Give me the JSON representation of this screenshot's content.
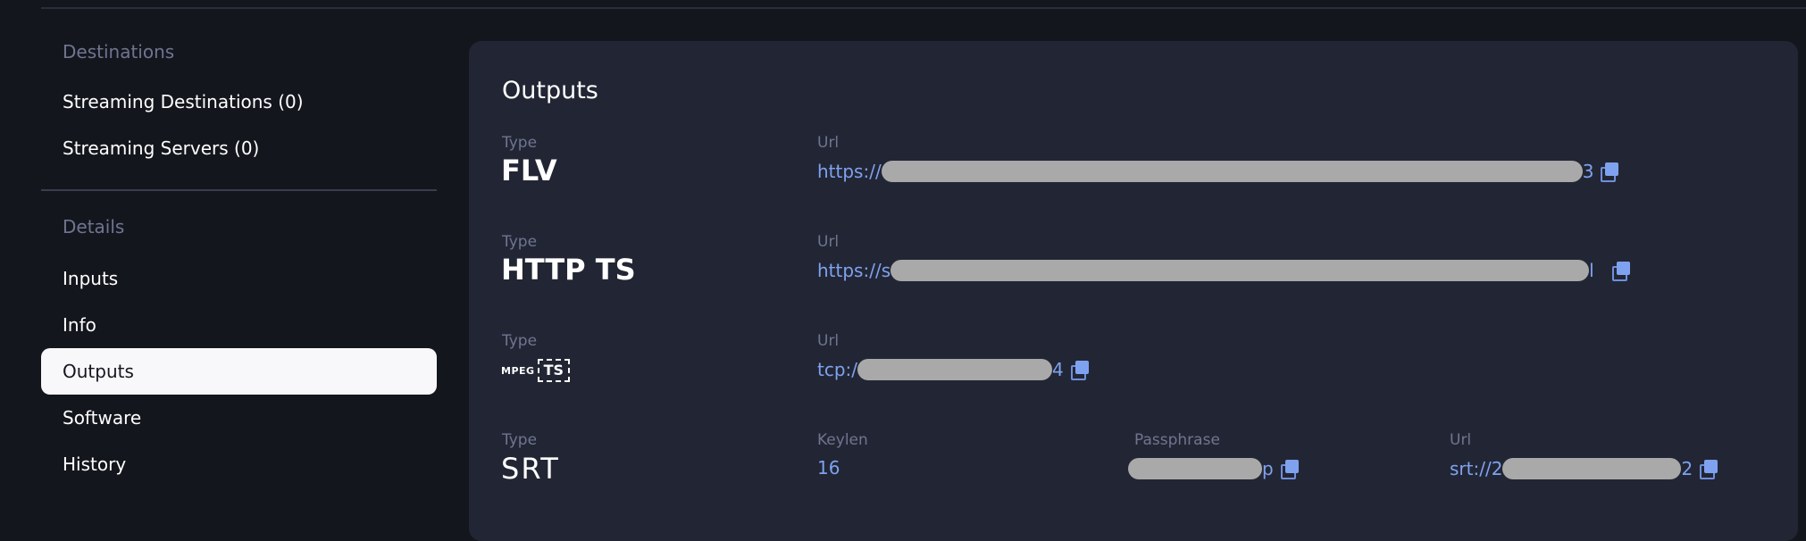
{
  "sidebar": {
    "destinations_title": "Destinations",
    "destinations": [
      {
        "label": "Streaming Destinations (0)"
      },
      {
        "label": "Streaming Servers (0)"
      }
    ],
    "details_title": "Details",
    "details": [
      {
        "label": "Inputs"
      },
      {
        "label": "Info"
      },
      {
        "label": "Outputs",
        "active": true
      },
      {
        "label": "Software"
      },
      {
        "label": "History"
      }
    ]
  },
  "outputs": {
    "title": "Outputs",
    "type_label": "Type",
    "url_label": "Url",
    "keylen_label": "Keylen",
    "passphrase_label": "Passphrase",
    "rows": [
      {
        "type": "FLV",
        "url_prefix": "https://",
        "url_suffix": "3"
      },
      {
        "type": "HTTP TS",
        "url_prefix": "https://s",
        "url_suffix": "l"
      },
      {
        "type_logo": "MPEG TS",
        "type_logo_small": "MPEG",
        "type_logo_big": "TS",
        "url_prefix": "tcp:/",
        "url_suffix": "4"
      },
      {
        "type_logo": "SRT",
        "keylen": "16",
        "passphrase_suffix": "p",
        "url_prefix": "srt://2",
        "url_suffix": "2"
      }
    ]
  },
  "colors": {
    "background": "#14161e",
    "panel": "#222634",
    "link": "#7fa2f0",
    "label": "#6f7590",
    "active_item": "#f8f7f9"
  },
  "icons": [
    "copy-icon"
  ]
}
